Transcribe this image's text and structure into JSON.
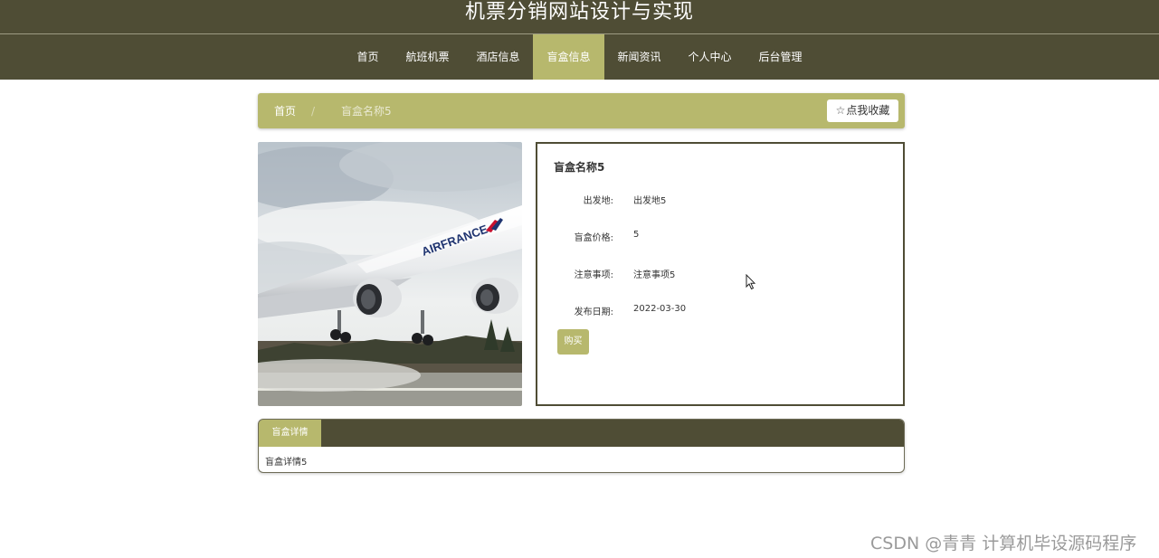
{
  "header": {
    "site_title": "机票分销网站设计与实现",
    "nav": [
      {
        "label": "首页"
      },
      {
        "label": "航班机票"
      },
      {
        "label": "酒店信息"
      },
      {
        "label": "盲盒信息"
      },
      {
        "label": "新闻资讯"
      },
      {
        "label": "个人中心"
      },
      {
        "label": "后台管理"
      }
    ],
    "active_nav": "盲盒信息"
  },
  "breadcrumb": {
    "home": "首页",
    "separator": "/",
    "current": "盲盒名称5"
  },
  "favorite_button": {
    "icon": "star-outline-icon",
    "label": "点我收藏"
  },
  "product": {
    "image": "airplane-photo",
    "title": "盲盒名称5",
    "fields": [
      {
        "label": "出发地:",
        "value": "出发地5"
      },
      {
        "label": "盲盒价格:",
        "value": "5"
      },
      {
        "label": "注意事项:",
        "value": "注意事项5"
      },
      {
        "label": "发布日期:",
        "value": "2022-03-30"
      }
    ],
    "buy_label": "购买"
  },
  "detail": {
    "tab_label": "盲盒详情",
    "content": "盲盒详情5"
  },
  "watermark": "CSDN @青青  计算机毕设源码程序",
  "colors": {
    "header_bg": "#4f4d35",
    "accent": "#b7b86d",
    "white": "#ffffff"
  }
}
